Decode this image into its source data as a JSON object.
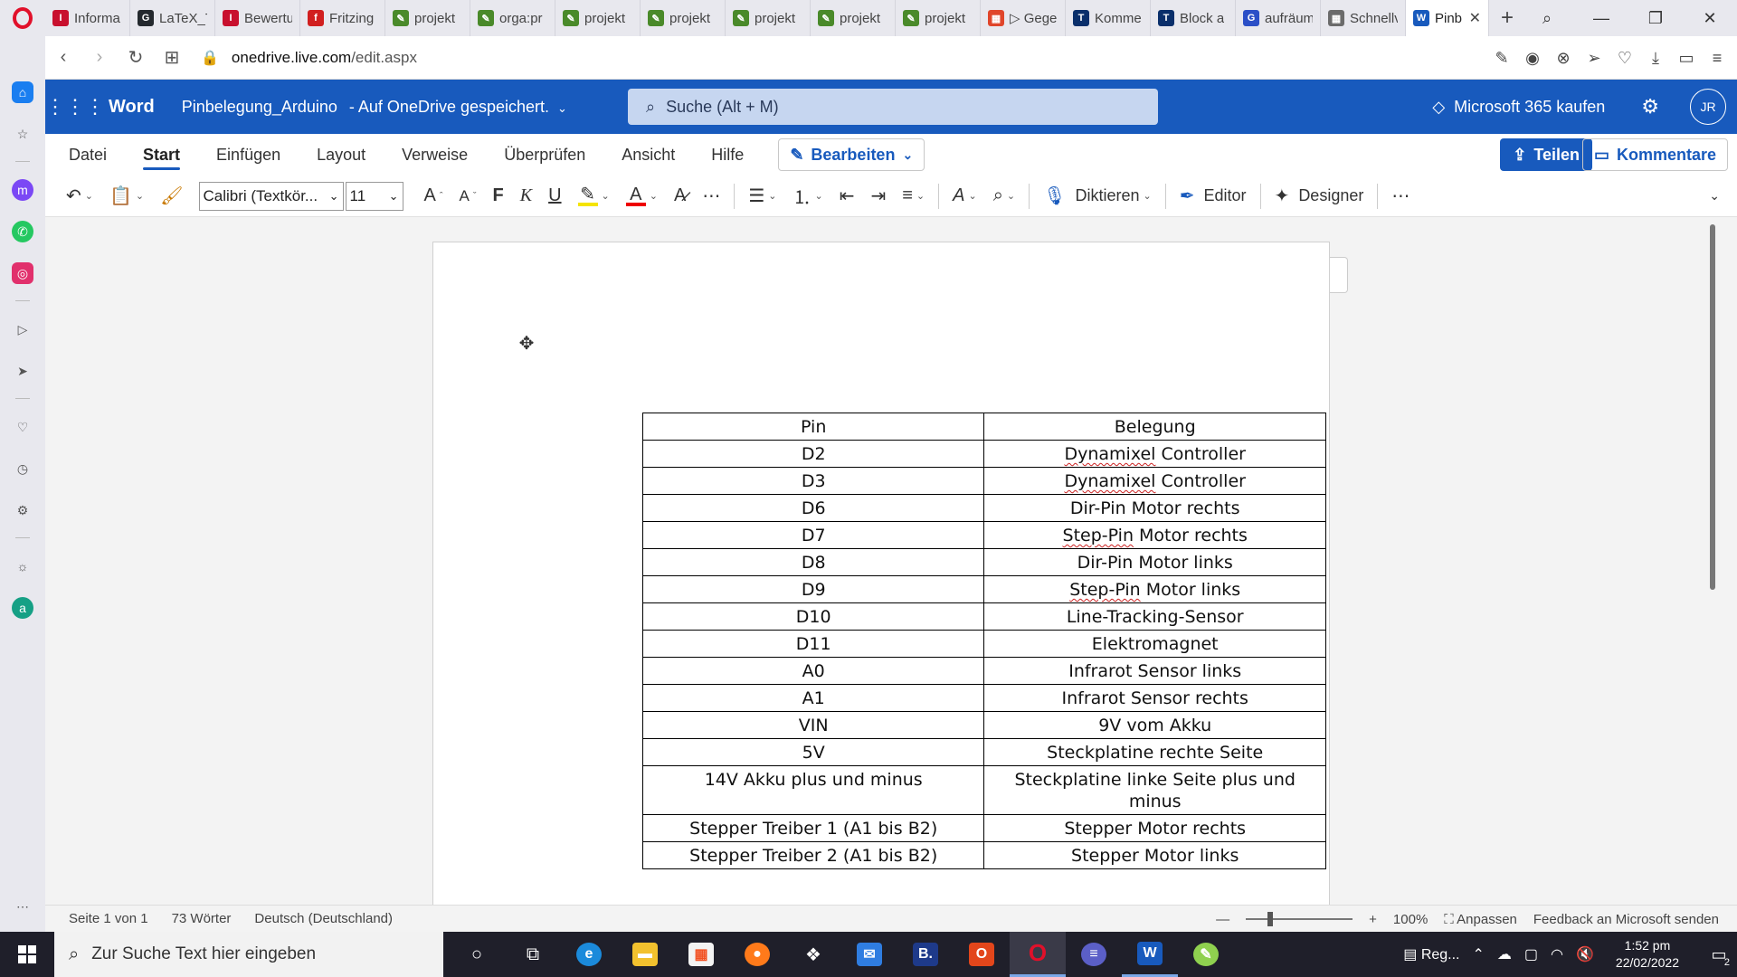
{
  "browser": {
    "tabs": [
      {
        "label": "Informa",
        "color": "#c8102e",
        "glyph": "I"
      },
      {
        "label": "LaTeX_T",
        "color": "#24292e",
        "glyph": "G"
      },
      {
        "label": "Bewertu",
        "color": "#c8102e",
        "glyph": "I"
      },
      {
        "label": "Fritzing",
        "color": "#d11f1f",
        "glyph": "f"
      },
      {
        "label": "projekt",
        "color": "#4a8a2a",
        "glyph": "✎"
      },
      {
        "label": "orga:pr",
        "color": "#4a8a2a",
        "glyph": "✎"
      },
      {
        "label": "projekt",
        "color": "#4a8a2a",
        "glyph": "✎"
      },
      {
        "label": "projekt",
        "color": "#4a8a2a",
        "glyph": "✎"
      },
      {
        "label": "projekt",
        "color": "#4a8a2a",
        "glyph": "✎"
      },
      {
        "label": "projekt",
        "color": "#4a8a2a",
        "glyph": "✎"
      },
      {
        "label": "projekt",
        "color": "#4a8a2a",
        "glyph": "✎"
      },
      {
        "label": "▷ Gege",
        "color": "#e0452a",
        "glyph": "▦"
      },
      {
        "label": "Komme",
        "color": "#0a2f6b",
        "glyph": "T"
      },
      {
        "label": "Block a",
        "color": "#0a2f6b",
        "glyph": "T"
      },
      {
        "label": "aufräum",
        "color": "#2b4fc7",
        "glyph": "G"
      },
      {
        "label": "Schnellv",
        "color": "#6b6b6b",
        "glyph": "▦"
      }
    ],
    "active_tab": {
      "label": "Pinb",
      "color": "#185abd",
      "glyph": "W"
    },
    "url_domain": "onedrive.live.com",
    "url_path": "/edit.aspx"
  },
  "word": {
    "app_name": "Word",
    "doc_title": "Pinbelegung_Arduino",
    "save_status": "- Auf OneDrive gespeichert.",
    "search_placeholder": "Suche (Alt + M)",
    "buy_label": "Microsoft 365 kaufen",
    "avatar_initials": "JR",
    "ribbon_tabs": [
      "Datei",
      "Start",
      "Einfügen",
      "Layout",
      "Verweise",
      "Überprüfen",
      "Ansicht",
      "Hilfe"
    ],
    "active_ribbon_tab": "Start",
    "edit_mode_label": "Bearbeiten",
    "share_label": "Teilen",
    "comments_label": "Kommentare",
    "font_name": "Calibri (Textkör...",
    "font_size": "11",
    "bold_label": "F",
    "italic_label": "K",
    "underline_label": "U",
    "dictate_label": "Diktieren",
    "editor_label": "Editor",
    "designer_label": "Designer",
    "highlight_color": "#f5e400",
    "font_color": "#e00000"
  },
  "table": {
    "header": [
      "Pin",
      "Belegung"
    ],
    "rows": [
      [
        "D2",
        "Dynamixel Controller"
      ],
      [
        "D3",
        "Dynamixel Controller"
      ],
      [
        "D6",
        "Dir-Pin Motor rechts"
      ],
      [
        "D7",
        "Step-Pin Motor rechts"
      ],
      [
        "D8",
        "Dir-Pin Motor links"
      ],
      [
        "D9",
        "Step-Pin Motor links"
      ],
      [
        "D10",
        "Line-Tracking-Sensor"
      ],
      [
        "D11",
        "Elektromagnet"
      ],
      [
        "A0",
        "Infrarot Sensor links"
      ],
      [
        "A1",
        "Infrarot Sensor rechts"
      ],
      [
        "VIN",
        "9V vom Akku"
      ],
      [
        "5V",
        "Steckplatine rechte Seite"
      ],
      [
        "14V Akku plus und minus",
        "Steckplatine linke Seite plus und minus"
      ],
      [
        "Stepper Treiber 1 (A1 bis B2)",
        "Stepper Motor rechts"
      ],
      [
        "Stepper Treiber 2 (A1 bis B2)",
        "Stepper Motor links"
      ]
    ]
  },
  "status": {
    "page": "Seite 1 von 1",
    "words": "73 Wörter",
    "language": "Deutsch (Deutschland)",
    "zoom": "100%",
    "fit": "Anpassen",
    "feedback": "Feedback an Microsoft senden"
  },
  "taskbar": {
    "search_placeholder": "Zur Suche Text hier eingeben",
    "weather": "Reg...",
    "time": "1:52 pm",
    "date": "22/02/2022",
    "notifications": "2"
  }
}
